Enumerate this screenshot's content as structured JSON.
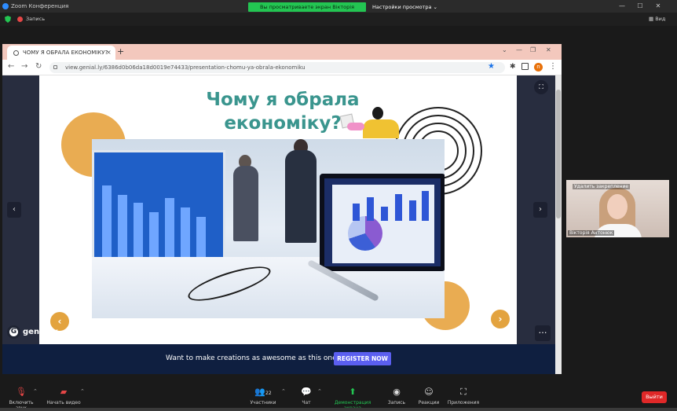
{
  "zoom": {
    "window_title": "Zoom Конференция",
    "share_banner": "Вы просматриваете экран Вікторія Антонюк",
    "view_options": "Настройки просмотра ⌄",
    "recording_label": "Запись",
    "view_label": "Вид",
    "colors": {
      "accent": "#2d8cff",
      "share_green": "#23c552",
      "leave_red": "#e02828"
    }
  },
  "browser": {
    "tab_title": "ЧОМУ Я ОБРАЛА ЕКОНОМІКУ?",
    "tab_close": "×",
    "new_tab": "+",
    "window_controls": [
      "⌄",
      "—",
      "❐",
      "✕"
    ],
    "nav": {
      "back": "←",
      "forward": "→",
      "reload": "↻"
    },
    "url": "view.genial.ly/6386d0b06da18d0019e74433/presentation-chomu-ya-obrala-ekonomiku",
    "avatar_letter": "n",
    "icons": {
      "star": "★",
      "ext": "✱",
      "kebab": "⋮"
    }
  },
  "slide": {
    "title_line1": "Чому я обрала",
    "title_line2": "економіку?",
    "prev_arrow": "‹",
    "next_arrow": "›",
    "side_prev": "‹",
    "side_next": "›",
    "lock": "🔓",
    "more": "…",
    "logo_mark": "G",
    "logo_text": "genially",
    "colors": {
      "title": "#3a958e",
      "accent": "#e9ac52"
    }
  },
  "promo": {
    "text": "Want to make creations as awesome as this one?",
    "button": "REGISTER NOW"
  },
  "video": {
    "unpin_label": "Удалить закрепление",
    "participant_name": "Вікторія Антонюк"
  },
  "toolbar": {
    "mic": "Включить звук",
    "video": "Начать видео",
    "participants": "Участники",
    "participants_count": "22",
    "chat": "Чат",
    "share": "Демонстрация экрана",
    "record": "Запись",
    "reactions": "Реакции",
    "apps": "Приложения",
    "leave": "Выйти"
  }
}
